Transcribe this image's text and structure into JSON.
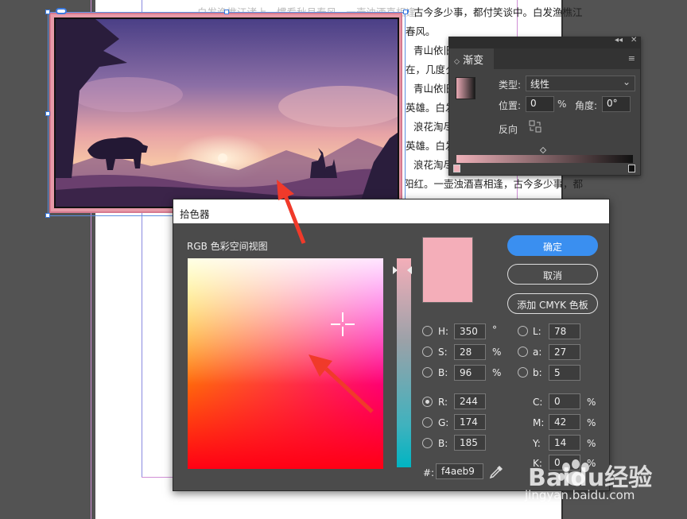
{
  "document": {
    "text_lines_right": [
      "古今多少事，都付笑谈中。白发渔樵江",
      "",
      "",
      "",
      "",
      "",
      "",
      "",
      "",
      "阳红。一壶浊酒喜相逢，古今多少事，都"
    ],
    "text_lines_left": [
      "白发渔樵江渚上，惯看秋月春风。一壶浊酒喜相逢",
      "春风。",
      "青山依旧",
      "在，几度夕",
      "青山依旧",
      "英雄。白发",
      "浪花淘尽",
      "英雄。白发",
      "",
      "浪花淘尽",
      ""
    ]
  },
  "gradient_panel": {
    "tab_title": "渐变",
    "collapse_glyph": "◂◂",
    "close_glyph": "✕",
    "menu_glyph": "≡",
    "type_label": "类型:",
    "type_value": "线性",
    "position_label": "位置:",
    "position_value": "0",
    "position_unit": "%",
    "angle_label": "角度:",
    "angle_value": "0°",
    "reverse_label": "反向",
    "colors": {
      "start": "#efb1b9",
      "end": "#111111"
    }
  },
  "color_picker": {
    "title": "拾色器",
    "colorspace_label": "RGB 色彩空间视图",
    "buttons": {
      "ok": "确定",
      "cancel": "取消",
      "add_cmyk": "添加 CMYK 色板"
    },
    "hsb": [
      {
        "label": "H:",
        "value": "350",
        "unit": "°"
      },
      {
        "label": "S:",
        "value": "28",
        "unit": "%"
      },
      {
        "label": "B:",
        "value": "96",
        "unit": "%"
      }
    ],
    "lab": [
      {
        "label": "L:",
        "value": "78"
      },
      {
        "label": "a:",
        "value": "27"
      },
      {
        "label": "b:",
        "value": "5"
      }
    ],
    "rgb": [
      {
        "label": "R:",
        "value": "244"
      },
      {
        "label": "G:",
        "value": "174"
      },
      {
        "label": "B:",
        "value": "185"
      }
    ],
    "cmyk": [
      {
        "label": "C:",
        "value": "0",
        "unit": "%"
      },
      {
        "label": "M:",
        "value": "42",
        "unit": "%"
      },
      {
        "label": "Y:",
        "value": "14",
        "unit": "%"
      },
      {
        "label": "K:",
        "value": "0",
        "unit": "%"
      }
    ],
    "hex_label": "#:",
    "hex_value": "f4aeb9",
    "selected_color": "#f4aeb9",
    "accent": "#3a8ff0"
  },
  "watermark": {
    "brand": "Baidu经验",
    "url": "jingyan.baidu.com"
  }
}
